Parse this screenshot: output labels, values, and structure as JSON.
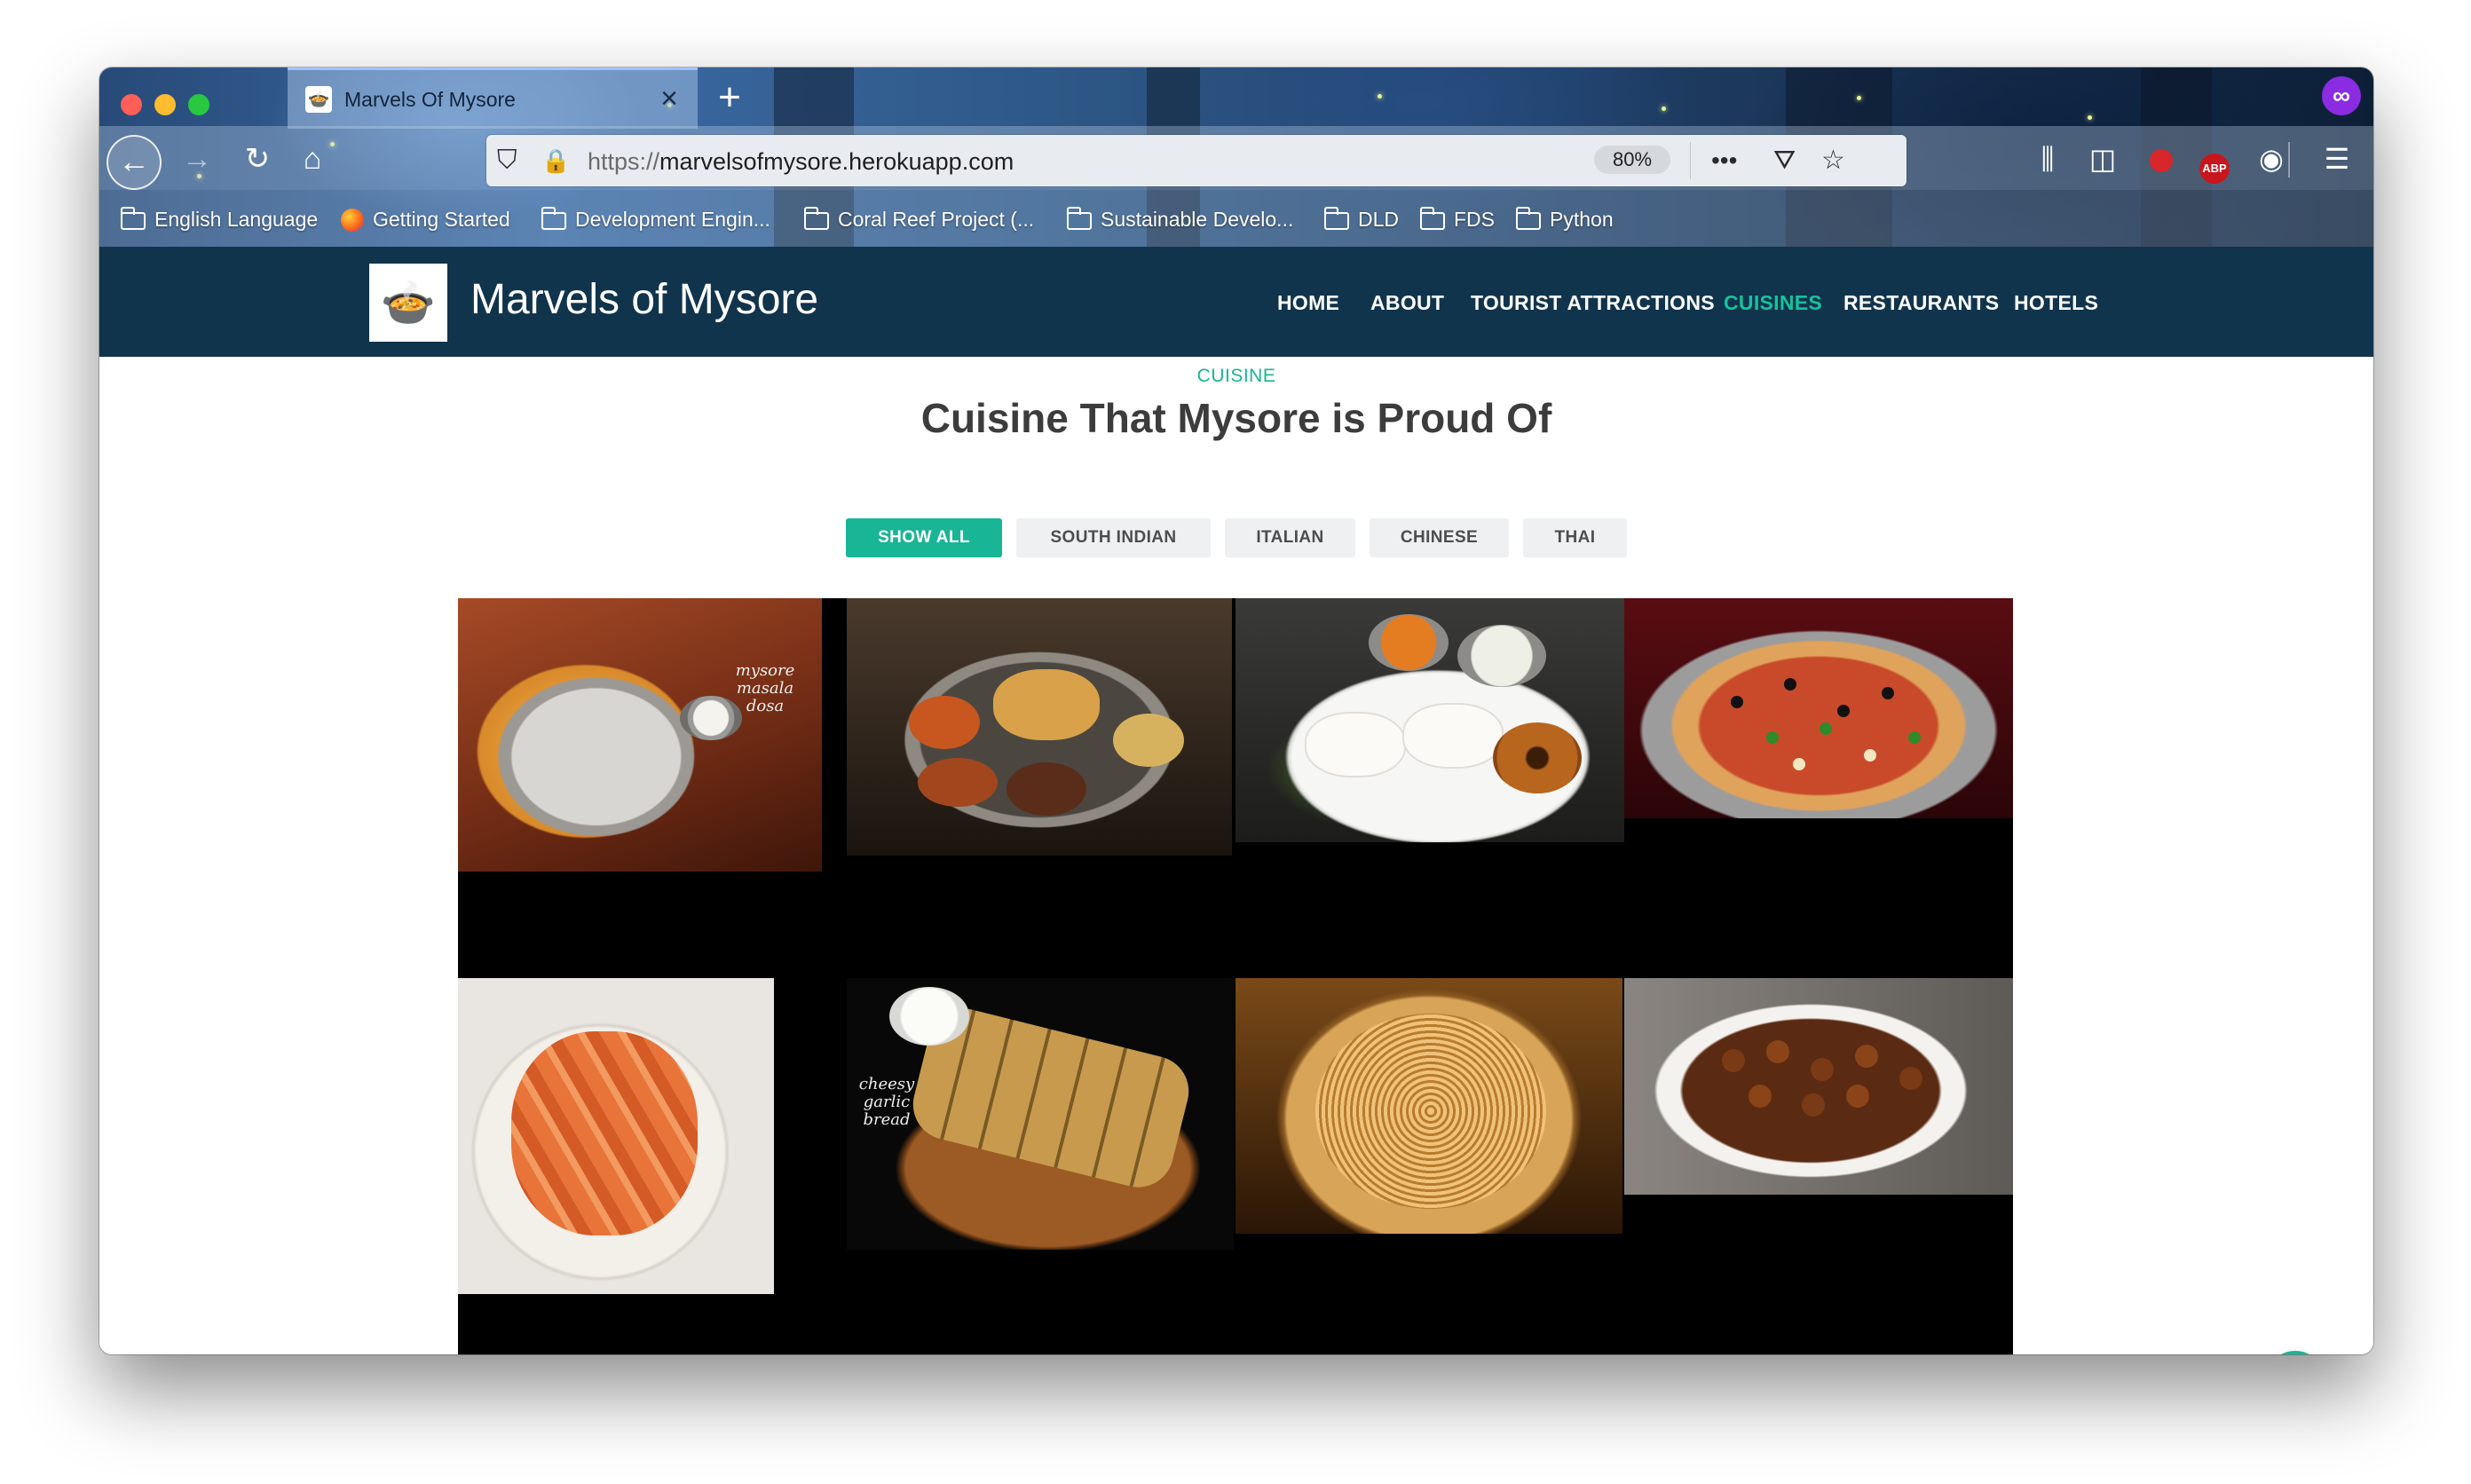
{
  "browser": {
    "tab_title": "Marvels Of Mysore",
    "tab_favicon": "🍲",
    "new_tab": "+",
    "close_tab": "×",
    "url_scheme": "https://",
    "url_host": "marvelsofmysore.herokuapp.com",
    "zoom": "80%",
    "abp_label": "ABP",
    "bookmarks": [
      {
        "label": "English Language",
        "icon": "folder-icon"
      },
      {
        "label": "Getting Started",
        "icon": "firefox-icon"
      },
      {
        "label": "Development Engin...",
        "icon": "folder-icon"
      },
      {
        "label": "Coral Reef Project (...",
        "icon": "folder-icon"
      },
      {
        "label": "Sustainable Develo...",
        "icon": "folder-icon"
      },
      {
        "label": "DLD",
        "icon": "folder-icon"
      },
      {
        "label": "FDS",
        "icon": "folder-icon"
      },
      {
        "label": "Python",
        "icon": "folder-icon"
      }
    ]
  },
  "site": {
    "brand": "Marvels of Mysore",
    "nav": [
      {
        "label": "HOME",
        "active": false
      },
      {
        "label": "ABOUT",
        "active": false
      },
      {
        "label": "TOURIST ATTRACTIONS",
        "active": false
      },
      {
        "label": "CUISINES",
        "active": true
      },
      {
        "label": "RESTAURANTS",
        "active": false
      },
      {
        "label": "HOTELS",
        "active": false
      }
    ],
    "section_eyebrow": "CUISINE",
    "section_title": "Cuisine That Mysore is Proud Of",
    "filters": [
      {
        "label": "SHOW ALL",
        "active": true
      },
      {
        "label": "SOUTH INDIAN",
        "active": false
      },
      {
        "label": "ITALIAN",
        "active": false
      },
      {
        "label": "CHINESE",
        "active": false
      },
      {
        "label": "THAI",
        "active": false
      }
    ],
    "gallery": [
      {
        "name": "mysore-masala-dosa",
        "caption": "mysore masala dosa"
      },
      {
        "name": "south-indian-thali",
        "caption": ""
      },
      {
        "name": "idli-vada",
        "caption": ""
      },
      {
        "name": "pizza",
        "caption": ""
      },
      {
        "name": "pasta",
        "caption": ""
      },
      {
        "name": "cheesy-garlic-bread",
        "caption": "cheesy garlic bread"
      },
      {
        "name": "hakka-noodles",
        "caption": ""
      },
      {
        "name": "manchurian",
        "caption": ""
      }
    ],
    "back_to_top_icon": "chevron-up-icon"
  },
  "colors": {
    "nav_bg": "#11344d",
    "accent": "#18b596",
    "gallery_bg": "#000000"
  }
}
